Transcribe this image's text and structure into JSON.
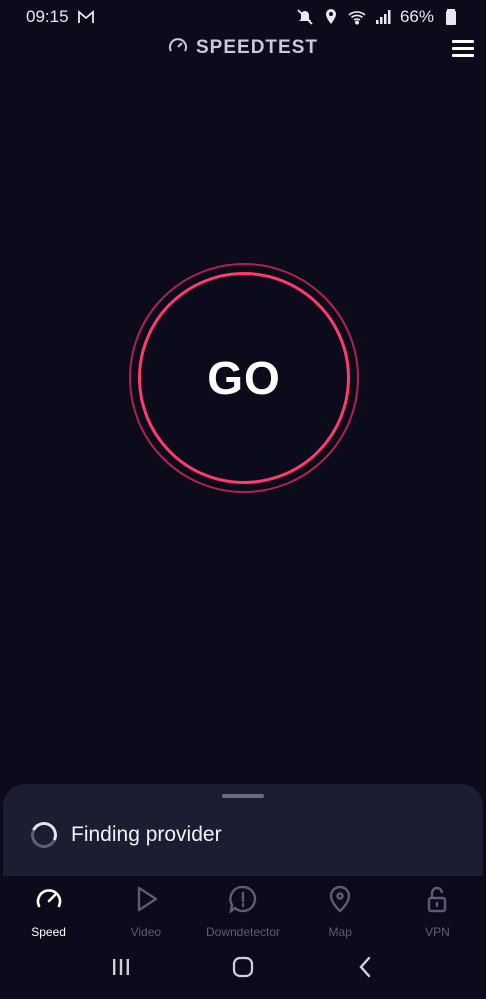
{
  "status_bar": {
    "time": "09:15",
    "battery": "66%",
    "icons": [
      "gmail-icon",
      "mute-icon",
      "location-icon",
      "wifi-icon",
      "signal-icon",
      "battery-icon"
    ]
  },
  "header": {
    "title": "SPEEDTEST",
    "logo_icon": "speedometer-icon",
    "menu_icon": "hamburger-menu-icon"
  },
  "main": {
    "go_label": "GO",
    "accent_color": "#ff3b6b",
    "accent_outer_color": "#b0234e"
  },
  "sheet": {
    "status_text": "Finding provider"
  },
  "tabs": [
    {
      "label": "Speed",
      "icon": "speedometer-icon",
      "active": true
    },
    {
      "label": "Video",
      "icon": "play-icon",
      "active": false
    },
    {
      "label": "Downdetector",
      "icon": "alert-icon",
      "active": false
    },
    {
      "label": "Map",
      "icon": "map-pin-icon",
      "active": false
    },
    {
      "label": "VPN",
      "icon": "unlock-icon",
      "active": false
    }
  ],
  "nav": {
    "recents_icon": "recents-icon",
    "home_icon": "home-icon",
    "back_icon": "back-icon"
  }
}
